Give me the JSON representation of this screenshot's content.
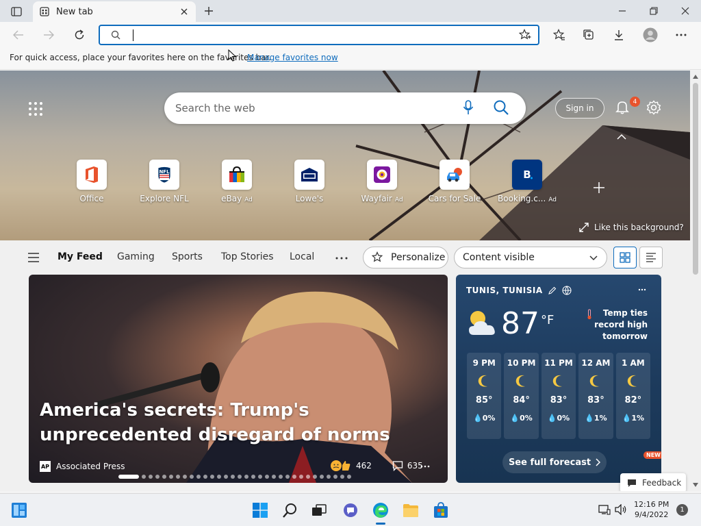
{
  "browser": {
    "tab_title": "New tab",
    "address_value": "",
    "favbar_text": "For quick access, place your favorites here on the favorites bar.",
    "favbar_link": "Manage favorites now"
  },
  "newtab": {
    "search_placeholder": "Search the web",
    "signin_label": "Sign in",
    "notification_count": "4",
    "quick_links": [
      {
        "label": "Office",
        "ad": ""
      },
      {
        "label": "Explore NFL",
        "ad": ""
      },
      {
        "label": "eBay",
        "ad": "Ad"
      },
      {
        "label": "Lowe's",
        "ad": ""
      },
      {
        "label": "Wayfair",
        "ad": "Ad"
      },
      {
        "label": "Cars for Sale",
        "ad": ""
      },
      {
        "label": "Booking.c...",
        "ad": "Ad"
      }
    ],
    "like_background": "Like this background?"
  },
  "feed_nav": {
    "items": [
      "My Feed",
      "Gaming",
      "Sports",
      "Top Stories",
      "Local"
    ],
    "personalize_label": "Personalize",
    "content_visible_label": "Content visible"
  },
  "hero_story": {
    "headline": "America's secrets: Trump's unprecedented disregard of norms",
    "source": "Associated Press",
    "source_logo": "AP",
    "reactions": "462",
    "comments": "635"
  },
  "weather": {
    "location": "TUNIS, TUNISIA",
    "temperature": "87",
    "unit": "°F",
    "alert": "Temp ties record high tomorrow",
    "hours": [
      {
        "time": "9 PM",
        "temp": "85°",
        "precip": "0%"
      },
      {
        "time": "10 PM",
        "temp": "84°",
        "precip": "0%"
      },
      {
        "time": "11 PM",
        "temp": "83°",
        "precip": "0%"
      },
      {
        "time": "12 AM",
        "temp": "83°",
        "precip": "1%"
      },
      {
        "time": "1 AM",
        "temp": "82°",
        "precip": "1%"
      }
    ],
    "forecast_label": "See full forecast",
    "new_badge": "NEW"
  },
  "feedback_label": "Feedback",
  "taskbar": {
    "time": "12:16 PM",
    "date": "9/4/2022",
    "notification_count": "1"
  },
  "colors": {
    "accent": "#0f6cbd",
    "badge": "#e8532d",
    "weather_card": "#1d3b5d"
  }
}
